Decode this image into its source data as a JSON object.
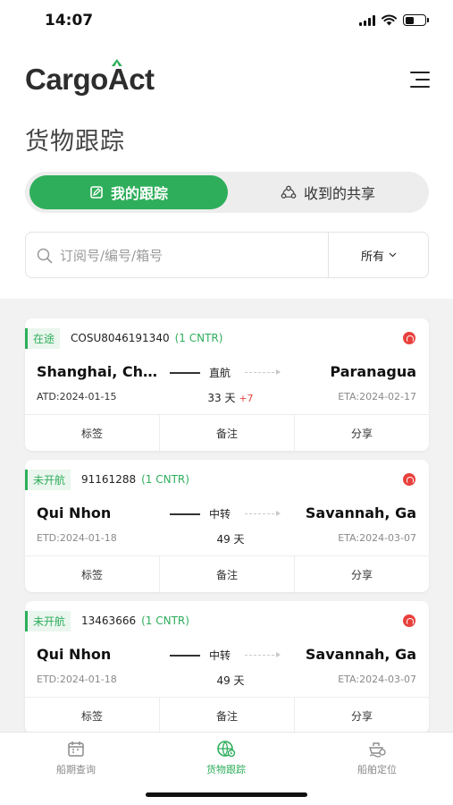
{
  "status_bar": {
    "time": "14:07",
    "battery_level": 0.45
  },
  "header": {
    "logo_text_1": "Cargo",
    "logo_text_2": "A",
    "logo_text_3": "ct",
    "menu_icon": "hamburger-icon"
  },
  "page": {
    "title": "货物跟踪"
  },
  "segment": {
    "active_label": "我的跟踪",
    "active_icon": "edit-doc-icon",
    "inactive_label": "收到的共享",
    "inactive_icon": "share-icon"
  },
  "search": {
    "placeholder": "订阅号/编号/箱号",
    "value": "",
    "filter_label": "所有"
  },
  "colors": {
    "accent": "#2eae5b",
    "alert": "#e8413d"
  },
  "shipments": [
    {
      "status": "在途",
      "booking": "COSU8046191340",
      "cntr": "(1 CNTR)",
      "from": "Shanghai, Ch…",
      "to": "Paranagua",
      "route": "直航",
      "date_from": "ATD:2024-01-15",
      "date_to": "ETA:2024-02-17",
      "days": "33 天",
      "days_delta": "+7",
      "actions": [
        "标签",
        "备注",
        "分享"
      ]
    },
    {
      "status": "未开航",
      "booking": "91161288",
      "cntr": "(1 CNTR)",
      "from": "Qui Nhon",
      "to": "Savannah, Ga",
      "route": "中转",
      "date_from": "ETD:2024-01-18",
      "date_to": "ETA:2024-03-07",
      "days": "49 天",
      "days_delta": "",
      "actions": [
        "标签",
        "备注",
        "分享"
      ]
    },
    {
      "status": "未开航",
      "booking": "13463666",
      "cntr": "(1 CNTR)",
      "from": "Qui Nhon",
      "to": "Savannah, Ga",
      "route": "中转",
      "date_from": "ETD:2024-01-18",
      "date_to": "ETA:2024-03-07",
      "days": "49 天",
      "days_delta": "",
      "actions": [
        "标签",
        "备注",
        "分享"
      ]
    }
  ],
  "tabbar": [
    {
      "label": "船期查询",
      "icon": "calendar-icon",
      "active": false
    },
    {
      "label": "货物跟踪",
      "icon": "globe-icon",
      "active": true
    },
    {
      "label": "船舶定位",
      "icon": "ship-location-icon",
      "active": false
    }
  ]
}
